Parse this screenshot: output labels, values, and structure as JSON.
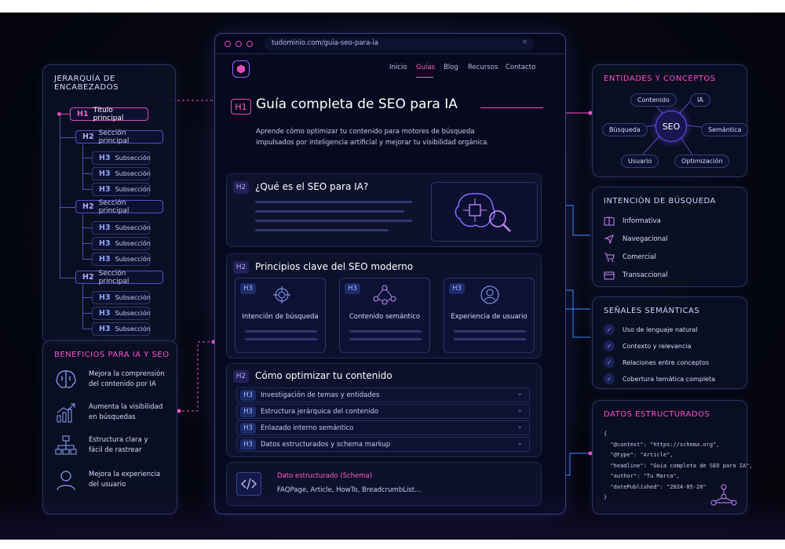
{
  "hierarchy": {
    "title": "JERARQUÍA DE ENCABEZADOS",
    "h1": {
      "tag": "H1",
      "label": "Título principal"
    },
    "sections": [
      {
        "tag": "H2",
        "label": "Sección principal",
        "subs": [
          {
            "tag": "H3",
            "label": "Subsección"
          },
          {
            "tag": "H3",
            "label": "Subsección"
          },
          {
            "tag": "H3",
            "label": "Subsección"
          }
        ]
      },
      {
        "tag": "H2",
        "label": "Sección principal",
        "subs": [
          {
            "tag": "H3",
            "label": "Subsección"
          },
          {
            "tag": "H3",
            "label": "Subsección"
          },
          {
            "tag": "H3",
            "label": "Subsección"
          }
        ]
      },
      {
        "tag": "H2",
        "label": "Sección principal",
        "subs": [
          {
            "tag": "H3",
            "label": "Subsección"
          },
          {
            "tag": "H3",
            "label": "Subsección"
          },
          {
            "tag": "H3",
            "label": "Subsección"
          }
        ]
      }
    ]
  },
  "benefits": {
    "title": "BENEFICIOS PARA IA Y SEO",
    "items": [
      {
        "icon": "brain-icon",
        "text1": "Mejora la comprensión",
        "text2": "del contenido por IA"
      },
      {
        "icon": "growth-chart-icon",
        "text1": "Aumenta la visibilidad",
        "text2": "en búsquedas"
      },
      {
        "icon": "sitemap-icon",
        "text1": "Estructura clara y",
        "text2": "fácil de rastrear"
      },
      {
        "icon": "user-icon",
        "text1": "Mejora la experiencia",
        "text2": "del usuario"
      }
    ]
  },
  "browser": {
    "url": "tudominio.com/guia-seo-para-ia",
    "close": "×",
    "nav": [
      "Inicio",
      "Guías",
      "Blog",
      "Recursos",
      "Contacto"
    ],
    "active_nav": "Guías",
    "h1_tag": "H1",
    "h1_title": "Guía completa de SEO para IA",
    "intro": "Aprende cómo optimizar tu contenido para motores de búsqueda impulsados por inteligencia artificial y mejorar tu visibilidad orgánica.",
    "section1": {
      "tag": "H2",
      "title": "¿Qué es el SEO para IA?"
    },
    "section2": {
      "tag": "H2",
      "title": "Principios clave del SEO moderno",
      "cards": [
        {
          "tag": "H3",
          "label": "Intención de búsqueda",
          "icon": "target-icon"
        },
        {
          "tag": "H3",
          "label": "Contenido semántico",
          "icon": "network-icon"
        },
        {
          "tag": "H3",
          "label": "Experiencia de usuario",
          "icon": "user-icon"
        }
      ]
    },
    "section3": {
      "tag": "H2",
      "title": "Cómo optimizar tu contenido",
      "rows": [
        {
          "tag": "H3",
          "label": "Investigación de temas y entidades"
        },
        {
          "tag": "H3",
          "label": "Estructura jerárquica del contenido"
        },
        {
          "tag": "H3",
          "label": "Enlazado interno semántico"
        },
        {
          "tag": "H3",
          "label": "Datos estructurados y schema markup"
        }
      ]
    },
    "schema": {
      "title": "Dato estructurado (Schema)",
      "subtitle": "FAQPage, Article, HowTo, BreadcrumbList..."
    }
  },
  "entities": {
    "title": "ENTIDADES Y CONCEPTOS",
    "center": "SEO",
    "nodes": [
      "Contenido",
      "IA",
      "Búsqueda",
      "Semántica",
      "Usuario",
      "Optimización"
    ]
  },
  "intent": {
    "title": "INTENCIÓN DE BÚSQUEDA",
    "items": [
      {
        "icon": "book-icon",
        "label": "Informativa"
      },
      {
        "icon": "navigation-arrow-icon",
        "label": "Navegacional"
      },
      {
        "icon": "cart-icon",
        "label": "Comercial"
      },
      {
        "icon": "card-icon",
        "label": "Transaccional"
      }
    ]
  },
  "signals": {
    "title": "SEÑALES SEMÁNTICAS",
    "items": [
      "Uso de lenguaje natural",
      "Contexto y relevancia",
      "Relaciones entre conceptos",
      "Cobertura temática completa"
    ]
  },
  "structured": {
    "title": "DATOS ESTRUCTURADOS",
    "code": "{\n  \"@context\": \"https://schema.org\",\n  \"@type\": \"Article\",\n  \"headline\": \"Guía completa de SEO para IA\",\n  \"author\": \"Tu Marca\",\n  \"datePublished\": \"2024-05-20\"\n}"
  },
  "colors": {
    "accent_pink": "#ff4fc8",
    "accent_violet": "#6a52ff",
    "accent_blue": "#3b8cff",
    "background": "#05060f"
  }
}
